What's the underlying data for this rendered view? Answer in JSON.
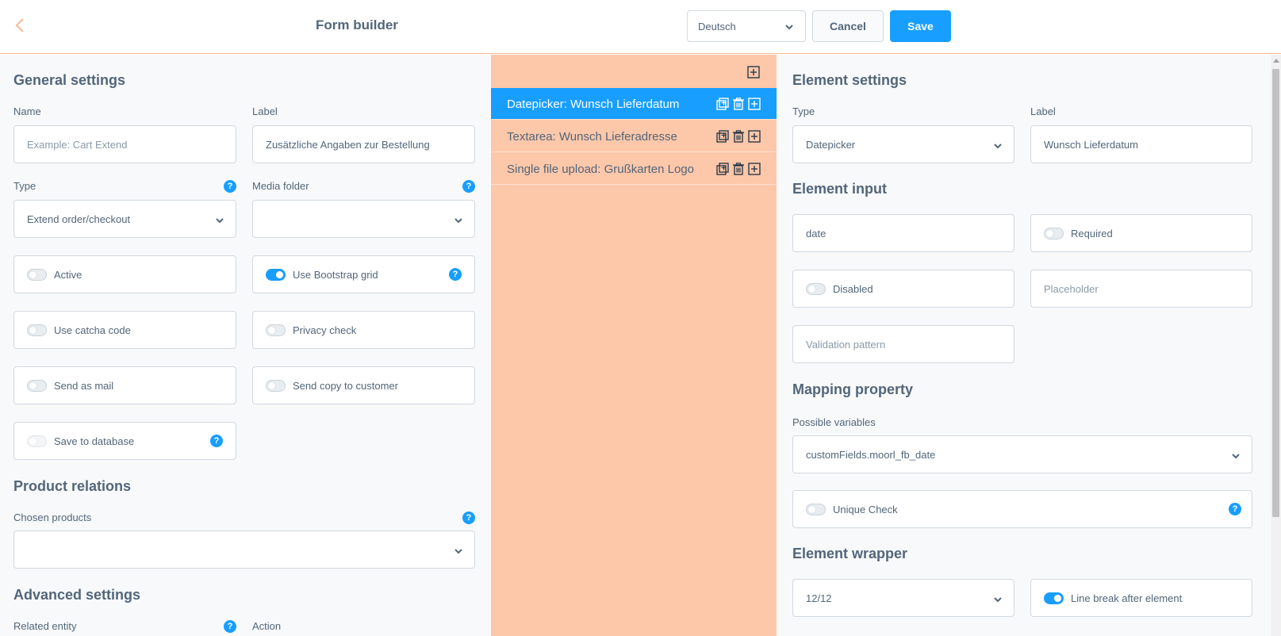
{
  "header": {
    "title": "Form builder",
    "language": "Deutsch",
    "cancel_label": "Cancel",
    "save_label": "Save"
  },
  "colors": {
    "accent": "#189eff",
    "middle_panel": "#fdc7aa",
    "text": "#52667a"
  },
  "general": {
    "title": "General settings",
    "name_label": "Name",
    "name_placeholder": "Example: Cart Extend",
    "label_label": "Label",
    "label_value": "Zusätzliche Angaben zur Bestellung",
    "type_label": "Type",
    "type_value": "Extend order/checkout",
    "media_label": "Media folder",
    "media_value": "",
    "toggles": {
      "active": "Active",
      "bootstrap": "Use Bootstrap grid",
      "catcha": "Use catcha code",
      "privacy": "Privacy check",
      "send_mail": "Send as mail",
      "send_copy": "Send copy to customer",
      "save_db": "Save to database"
    },
    "toggle_states": {
      "active": false,
      "bootstrap": true,
      "catcha": false,
      "privacy": false,
      "send_mail": false,
      "send_copy": false,
      "save_db": false
    }
  },
  "product": {
    "title": "Product relations",
    "chosen_label": "Chosen products",
    "chosen_value": ""
  },
  "advanced": {
    "title": "Advanced settings",
    "related_label": "Related entity",
    "action_label": "Action"
  },
  "elements": {
    "items": [
      {
        "label": "Datepicker: Wunsch Lieferdatum",
        "active": true
      },
      {
        "label": "Textarea: Wunsch Lieferadresse",
        "active": false
      },
      {
        "label": "Single file upload: Grußkarten Logo",
        "active": false
      }
    ]
  },
  "element_settings": {
    "title": "Element settings",
    "type_label": "Type",
    "type_value": "Datepicker",
    "label_label": "Label",
    "label_value": "Wunsch Lieferdatum",
    "input_title": "Element input",
    "input_value": "date",
    "required_label": "Required",
    "required_on": false,
    "disabled_label": "Disabled",
    "disabled_on": false,
    "placeholder_placeholder": "Placeholder",
    "validation_placeholder": "Validation pattern",
    "mapping_title": "Mapping property",
    "variables_label": "Possible variables",
    "variables_value": "customFields.moorl_fb_date",
    "unique_label": "Unique Check",
    "unique_on": false,
    "wrapper_title": "Element wrapper",
    "wrapper_value": "12/12",
    "linebreak_label": "Line break after element",
    "linebreak_on": true
  },
  "icons": {
    "back": "chevron-left-icon",
    "dropdown": "chevron-down-icon",
    "help": "question-icon",
    "duplicate": "duplicate-icon",
    "delete": "trash-icon",
    "add": "plus-square-icon"
  }
}
